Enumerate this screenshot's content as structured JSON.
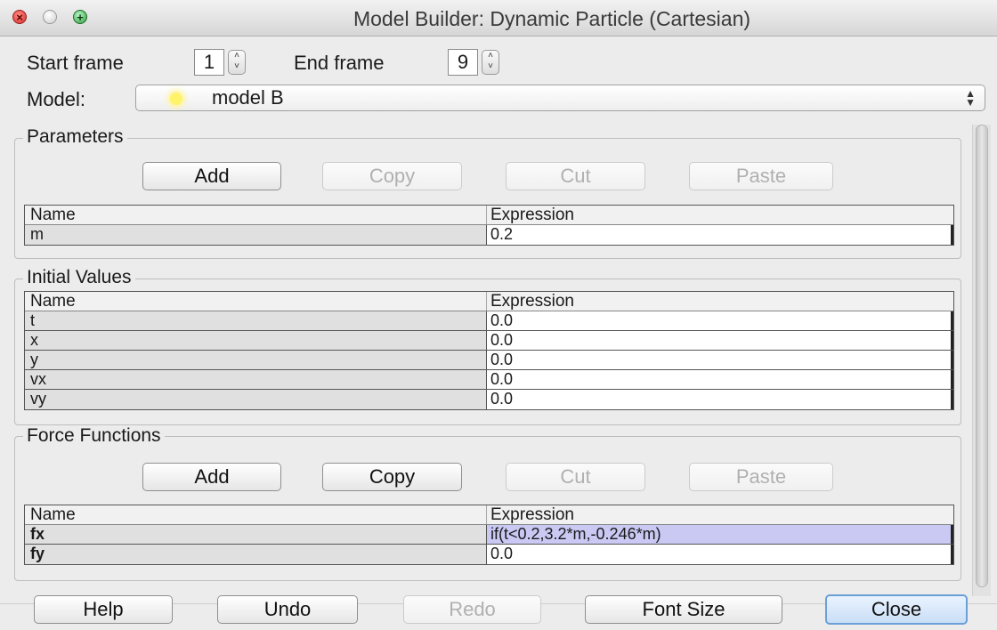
{
  "window": {
    "title": "Model Builder: Dynamic Particle (Cartesian)"
  },
  "frames": {
    "start_label": "Start frame",
    "start_value": "1",
    "end_label": "End frame",
    "end_value": "9"
  },
  "model": {
    "label": "Model:",
    "selected": "model B"
  },
  "parameters": {
    "title": "Parameters",
    "buttons": {
      "add": "Add",
      "copy": "Copy",
      "cut": "Cut",
      "paste": "Paste"
    },
    "columns": [
      "Name",
      "Expression"
    ],
    "rows": [
      {
        "name": "m",
        "expr": "0.2"
      }
    ]
  },
  "initial_values": {
    "title": "Initial Values",
    "columns": [
      "Name",
      "Expression"
    ],
    "rows": [
      {
        "name": "t",
        "expr": "0.0"
      },
      {
        "name": "x",
        "expr": "0.0"
      },
      {
        "name": "y",
        "expr": "0.0"
      },
      {
        "name": "vx",
        "expr": "0.0"
      },
      {
        "name": "vy",
        "expr": "0.0"
      }
    ]
  },
  "force_functions": {
    "title": "Force Functions",
    "buttons": {
      "add": "Add",
      "copy": "Copy",
      "cut": "Cut",
      "paste": "Paste"
    },
    "columns": [
      "Name",
      "Expression"
    ],
    "rows": [
      {
        "name": "fx",
        "expr": "if(t<0.2,3.2*m,-0.246*m)"
      },
      {
        "name": "fy",
        "expr": "0.0"
      }
    ]
  },
  "bottom_buttons": {
    "help": "Help",
    "undo": "Undo",
    "redo": "Redo",
    "font_size": "Font Size",
    "close": "Close"
  },
  "colors": {
    "selected_row": "#c9c9f4",
    "close_button": "#6a9fd8",
    "model_dot": "#fff36b"
  }
}
